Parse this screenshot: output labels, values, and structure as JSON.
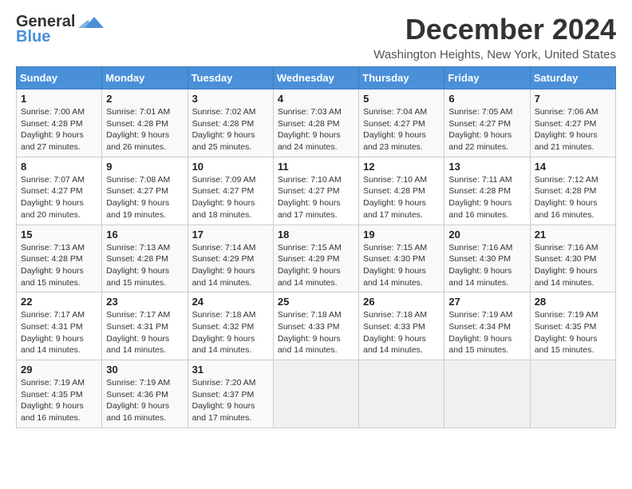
{
  "header": {
    "logo_line1": "General",
    "logo_line2": "Blue",
    "title": "December 2024",
    "location": "Washington Heights, New York, United States"
  },
  "days_of_week": [
    "Sunday",
    "Monday",
    "Tuesday",
    "Wednesday",
    "Thursday",
    "Friday",
    "Saturday"
  ],
  "weeks": [
    [
      {
        "day": "1",
        "sunrise": "7:00 AM",
        "sunset": "4:28 PM",
        "daylight": "9 hours and 27 minutes."
      },
      {
        "day": "2",
        "sunrise": "7:01 AM",
        "sunset": "4:28 PM",
        "daylight": "9 hours and 26 minutes."
      },
      {
        "day": "3",
        "sunrise": "7:02 AM",
        "sunset": "4:28 PM",
        "daylight": "9 hours and 25 minutes."
      },
      {
        "day": "4",
        "sunrise": "7:03 AM",
        "sunset": "4:28 PM",
        "daylight": "9 hours and 24 minutes."
      },
      {
        "day": "5",
        "sunrise": "7:04 AM",
        "sunset": "4:27 PM",
        "daylight": "9 hours and 23 minutes."
      },
      {
        "day": "6",
        "sunrise": "7:05 AM",
        "sunset": "4:27 PM",
        "daylight": "9 hours and 22 minutes."
      },
      {
        "day": "7",
        "sunrise": "7:06 AM",
        "sunset": "4:27 PM",
        "daylight": "9 hours and 21 minutes."
      }
    ],
    [
      {
        "day": "8",
        "sunrise": "7:07 AM",
        "sunset": "4:27 PM",
        "daylight": "9 hours and 20 minutes."
      },
      {
        "day": "9",
        "sunrise": "7:08 AM",
        "sunset": "4:27 PM",
        "daylight": "9 hours and 19 minutes."
      },
      {
        "day": "10",
        "sunrise": "7:09 AM",
        "sunset": "4:27 PM",
        "daylight": "9 hours and 18 minutes."
      },
      {
        "day": "11",
        "sunrise": "7:10 AM",
        "sunset": "4:27 PM",
        "daylight": "9 hours and 17 minutes."
      },
      {
        "day": "12",
        "sunrise": "7:10 AM",
        "sunset": "4:28 PM",
        "daylight": "9 hours and 17 minutes."
      },
      {
        "day": "13",
        "sunrise": "7:11 AM",
        "sunset": "4:28 PM",
        "daylight": "9 hours and 16 minutes."
      },
      {
        "day": "14",
        "sunrise": "7:12 AM",
        "sunset": "4:28 PM",
        "daylight": "9 hours and 16 minutes."
      }
    ],
    [
      {
        "day": "15",
        "sunrise": "7:13 AM",
        "sunset": "4:28 PM",
        "daylight": "9 hours and 15 minutes."
      },
      {
        "day": "16",
        "sunrise": "7:13 AM",
        "sunset": "4:28 PM",
        "daylight": "9 hours and 15 minutes."
      },
      {
        "day": "17",
        "sunrise": "7:14 AM",
        "sunset": "4:29 PM",
        "daylight": "9 hours and 14 minutes."
      },
      {
        "day": "18",
        "sunrise": "7:15 AM",
        "sunset": "4:29 PM",
        "daylight": "9 hours and 14 minutes."
      },
      {
        "day": "19",
        "sunrise": "7:15 AM",
        "sunset": "4:30 PM",
        "daylight": "9 hours and 14 minutes."
      },
      {
        "day": "20",
        "sunrise": "7:16 AM",
        "sunset": "4:30 PM",
        "daylight": "9 hours and 14 minutes."
      },
      {
        "day": "21",
        "sunrise": "7:16 AM",
        "sunset": "4:30 PM",
        "daylight": "9 hours and 14 minutes."
      }
    ],
    [
      {
        "day": "22",
        "sunrise": "7:17 AM",
        "sunset": "4:31 PM",
        "daylight": "9 hours and 14 minutes."
      },
      {
        "day": "23",
        "sunrise": "7:17 AM",
        "sunset": "4:31 PM",
        "daylight": "9 hours and 14 minutes."
      },
      {
        "day": "24",
        "sunrise": "7:18 AM",
        "sunset": "4:32 PM",
        "daylight": "9 hours and 14 minutes."
      },
      {
        "day": "25",
        "sunrise": "7:18 AM",
        "sunset": "4:33 PM",
        "daylight": "9 hours and 14 minutes."
      },
      {
        "day": "26",
        "sunrise": "7:18 AM",
        "sunset": "4:33 PM",
        "daylight": "9 hours and 14 minutes."
      },
      {
        "day": "27",
        "sunrise": "7:19 AM",
        "sunset": "4:34 PM",
        "daylight": "9 hours and 15 minutes."
      },
      {
        "day": "28",
        "sunrise": "7:19 AM",
        "sunset": "4:35 PM",
        "daylight": "9 hours and 15 minutes."
      }
    ],
    [
      {
        "day": "29",
        "sunrise": "7:19 AM",
        "sunset": "4:35 PM",
        "daylight": "9 hours and 16 minutes."
      },
      {
        "day": "30",
        "sunrise": "7:19 AM",
        "sunset": "4:36 PM",
        "daylight": "9 hours and 16 minutes."
      },
      {
        "day": "31",
        "sunrise": "7:20 AM",
        "sunset": "4:37 PM",
        "daylight": "9 hours and 17 minutes."
      },
      null,
      null,
      null,
      null
    ]
  ],
  "labels": {
    "sunrise": "Sunrise:",
    "sunset": "Sunset:",
    "daylight": "Daylight:"
  }
}
